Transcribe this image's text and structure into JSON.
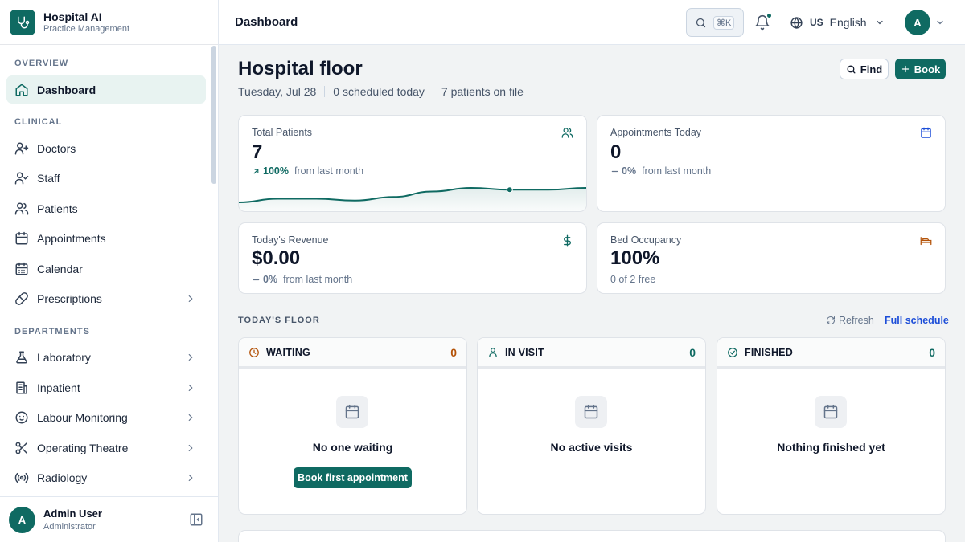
{
  "brand": {
    "title": "Hospital AI",
    "subtitle": "Practice Management"
  },
  "sidebar": {
    "sections": [
      {
        "label": "OVERVIEW",
        "items": [
          {
            "label": "Dashboard",
            "icon": "home-icon",
            "active": true
          }
        ]
      },
      {
        "label": "CLINICAL",
        "items": [
          {
            "label": "Doctors",
            "icon": "user-plus-icon"
          },
          {
            "label": "Staff",
            "icon": "user-check-icon"
          },
          {
            "label": "Patients",
            "icon": "users-icon"
          },
          {
            "label": "Appointments",
            "icon": "calendar-icon"
          },
          {
            "label": "Calendar",
            "icon": "calendar-days-icon"
          },
          {
            "label": "Prescriptions",
            "icon": "pill-icon",
            "chevron": true
          }
        ]
      },
      {
        "label": "DEPARTMENTS",
        "items": [
          {
            "label": "Laboratory",
            "icon": "flask-icon",
            "chevron": true
          },
          {
            "label": "Inpatient",
            "icon": "building-icon",
            "chevron": true
          },
          {
            "label": "Labour Monitoring",
            "icon": "baby-icon",
            "chevron": true
          },
          {
            "label": "Operating Theatre",
            "icon": "scissors-icon",
            "chevron": true
          },
          {
            "label": "Radiology",
            "icon": "radio-icon",
            "chevron": true
          }
        ]
      }
    ],
    "user": {
      "initial": "A",
      "name": "Admin User",
      "role": "Administrator"
    }
  },
  "header": {
    "title": "Dashboard",
    "search_kbd": "⌘K",
    "language": {
      "code": "US",
      "label": "English"
    },
    "avatar_initial": "A"
  },
  "page": {
    "title": "Hospital floor",
    "meta": [
      "Tuesday, Jul 28",
      "0 scheduled today",
      "7 patients on file"
    ],
    "find_label": "Find",
    "book_label": "Book"
  },
  "stats": {
    "total_patients": {
      "label": "Total Patients",
      "value": "7",
      "delta": "100%",
      "delta_suffix": "from last month"
    },
    "appointments_today": {
      "label": "Appointments Today",
      "value": "0",
      "delta": "0%",
      "delta_suffix": "from last month"
    },
    "revenue": {
      "label": "Today's Revenue",
      "value": "$0.00",
      "delta": "0%",
      "delta_suffix": "from last month"
    },
    "bed_occupancy": {
      "label": "Bed Occupancy",
      "value": "100%",
      "sub": "0 of 2 free"
    }
  },
  "sparkline": {
    "values": [
      2,
      4,
      4,
      3,
      5,
      8,
      10,
      9,
      9,
      10
    ],
    "highlight_index": 7
  },
  "floor": {
    "label": "TODAY'S FLOOR",
    "refresh_label": "Refresh",
    "full_schedule_label": "Full schedule",
    "columns": [
      {
        "title": "WAITING",
        "count": "0",
        "empty": "No one waiting",
        "cta": "Book first appointment",
        "color": "#b45309"
      },
      {
        "title": "IN VISIT",
        "count": "0",
        "empty": "No active visits",
        "color": "#0f6a62"
      },
      {
        "title": "FINISHED",
        "count": "0",
        "empty": "Nothing finished yet",
        "color": "#0f6a62"
      }
    ]
  },
  "colors": {
    "accent": "#0f6a62",
    "link": "#1d4ed8",
    "warning": "#b45309"
  }
}
